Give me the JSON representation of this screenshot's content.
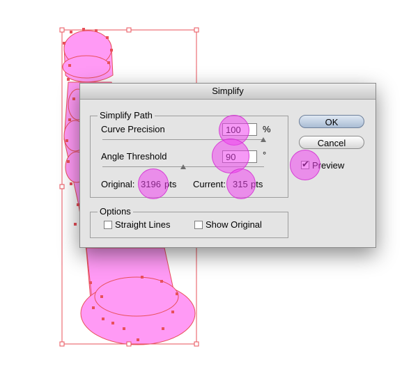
{
  "dialog": {
    "title": "Simplify",
    "simplify_path": {
      "title": "Simplify Path",
      "curve_precision": {
        "label": "Curve Precision",
        "value": "100",
        "unit": "%",
        "slider_level": 1.0
      },
      "angle_threshold": {
        "label": "Angle Threshold",
        "value": "90",
        "unit": "°",
        "slider_level": 0.5
      },
      "original": {
        "label": "Original:",
        "value": "3196",
        "unit": "pts"
      },
      "current": {
        "label": "Current:",
        "value": "315",
        "unit": "pts"
      }
    },
    "options": {
      "title": "Options",
      "straight_lines": {
        "label": "Straight Lines",
        "checked": false
      },
      "show_original": {
        "label": "Show Original",
        "checked": false
      }
    },
    "ok_label": "OK",
    "cancel_label": "Cancel",
    "preview": {
      "label": "Preview",
      "checked": true
    }
  },
  "colors": {
    "shape_fill": "#ff9af5",
    "path_stroke": "#e8505a",
    "highlight": "#ee46ee"
  }
}
